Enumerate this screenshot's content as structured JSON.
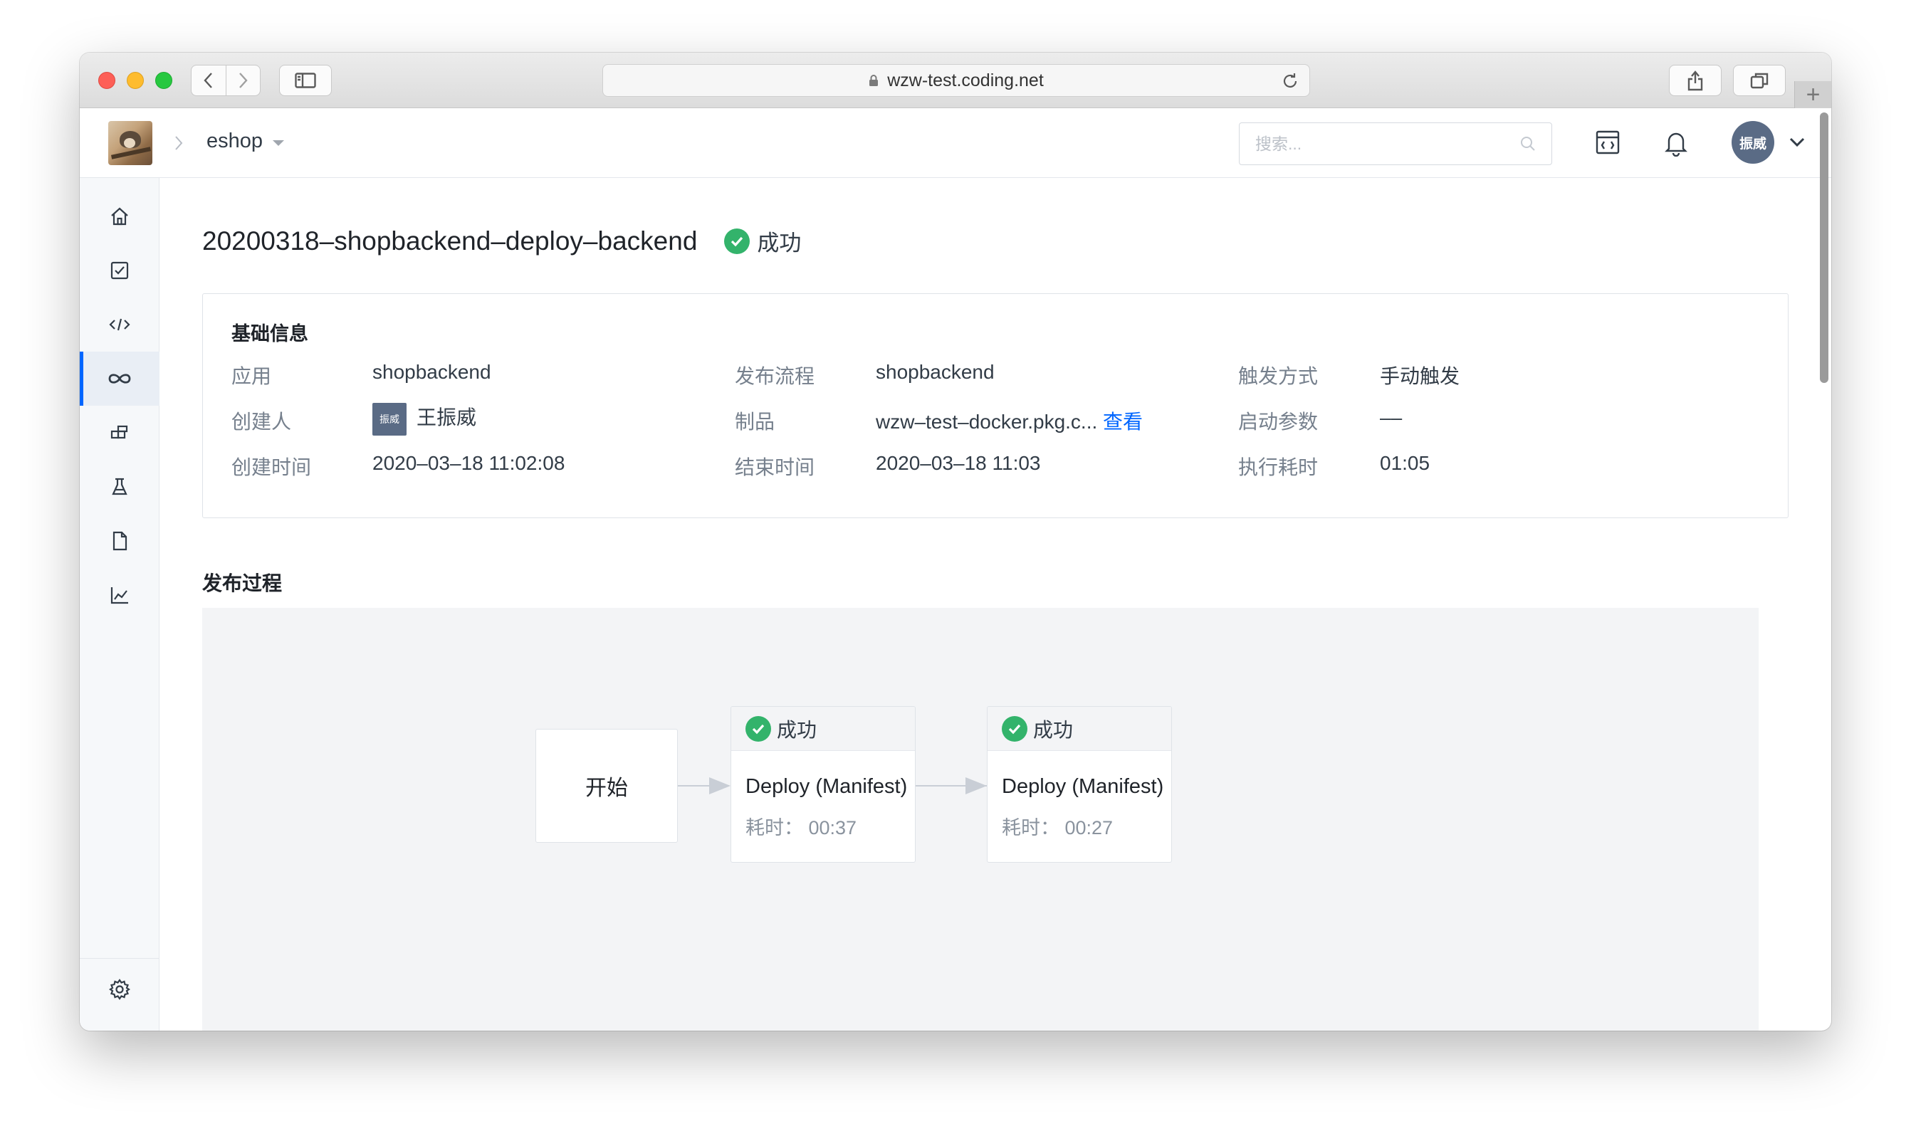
{
  "browser": {
    "url": "wzw-test.coding.net",
    "plus": "+"
  },
  "header": {
    "project_name": "eshop",
    "search_placeholder": "搜索...",
    "user_avatar": "振威"
  },
  "sidebar": {
    "items": [
      {
        "icon": "home-icon"
      },
      {
        "icon": "task-check-icon"
      },
      {
        "icon": "code-icon"
      },
      {
        "icon": "infinity-icon",
        "active": true
      },
      {
        "icon": "artifact-icon"
      },
      {
        "icon": "flask-icon"
      },
      {
        "icon": "document-icon"
      },
      {
        "icon": "chart-icon"
      }
    ],
    "bottom": [
      {
        "icon": "gear-icon"
      },
      {
        "icon": "double-chevron-right-icon"
      }
    ]
  },
  "page": {
    "title": "20200318–shopbackend–deploy–backend",
    "status": "成功",
    "status_color": "#33b36b"
  },
  "basic_info": {
    "title": "基础信息",
    "app_label": "应用",
    "app_value": "shopbackend",
    "flow_label": "发布流程",
    "flow_value": "shopbackend",
    "trigger_label": "触发方式",
    "trigger_value": "手动触发",
    "creator_label": "创建人",
    "creator_avatar": "振威",
    "creator_value": "王振威",
    "artifact_label": "制品",
    "artifact_value": "wzw–test–docker.pkg.c...",
    "artifact_link": "查看",
    "params_label": "启动参数",
    "params_value": "––",
    "created_label": "创建时间",
    "created_value": "2020–03–18 11:02:08",
    "ended_label": "结束时间",
    "ended_value": "2020–03–18 11:03",
    "duration_label": "执行耗时",
    "duration_value": "01:05"
  },
  "process": {
    "title": "发布过程",
    "start_label": "开始",
    "stages": [
      {
        "status": "成功",
        "name": "Deploy (Manifest)",
        "duration": "耗时：  00:37"
      },
      {
        "status": "成功",
        "name": "Deploy (Manifest)",
        "duration": "耗时：  00:27"
      }
    ]
  },
  "colors": {
    "accent": "#0066ff",
    "success": "#33b36b",
    "sidebar_bg": "#f6f8fa"
  }
}
